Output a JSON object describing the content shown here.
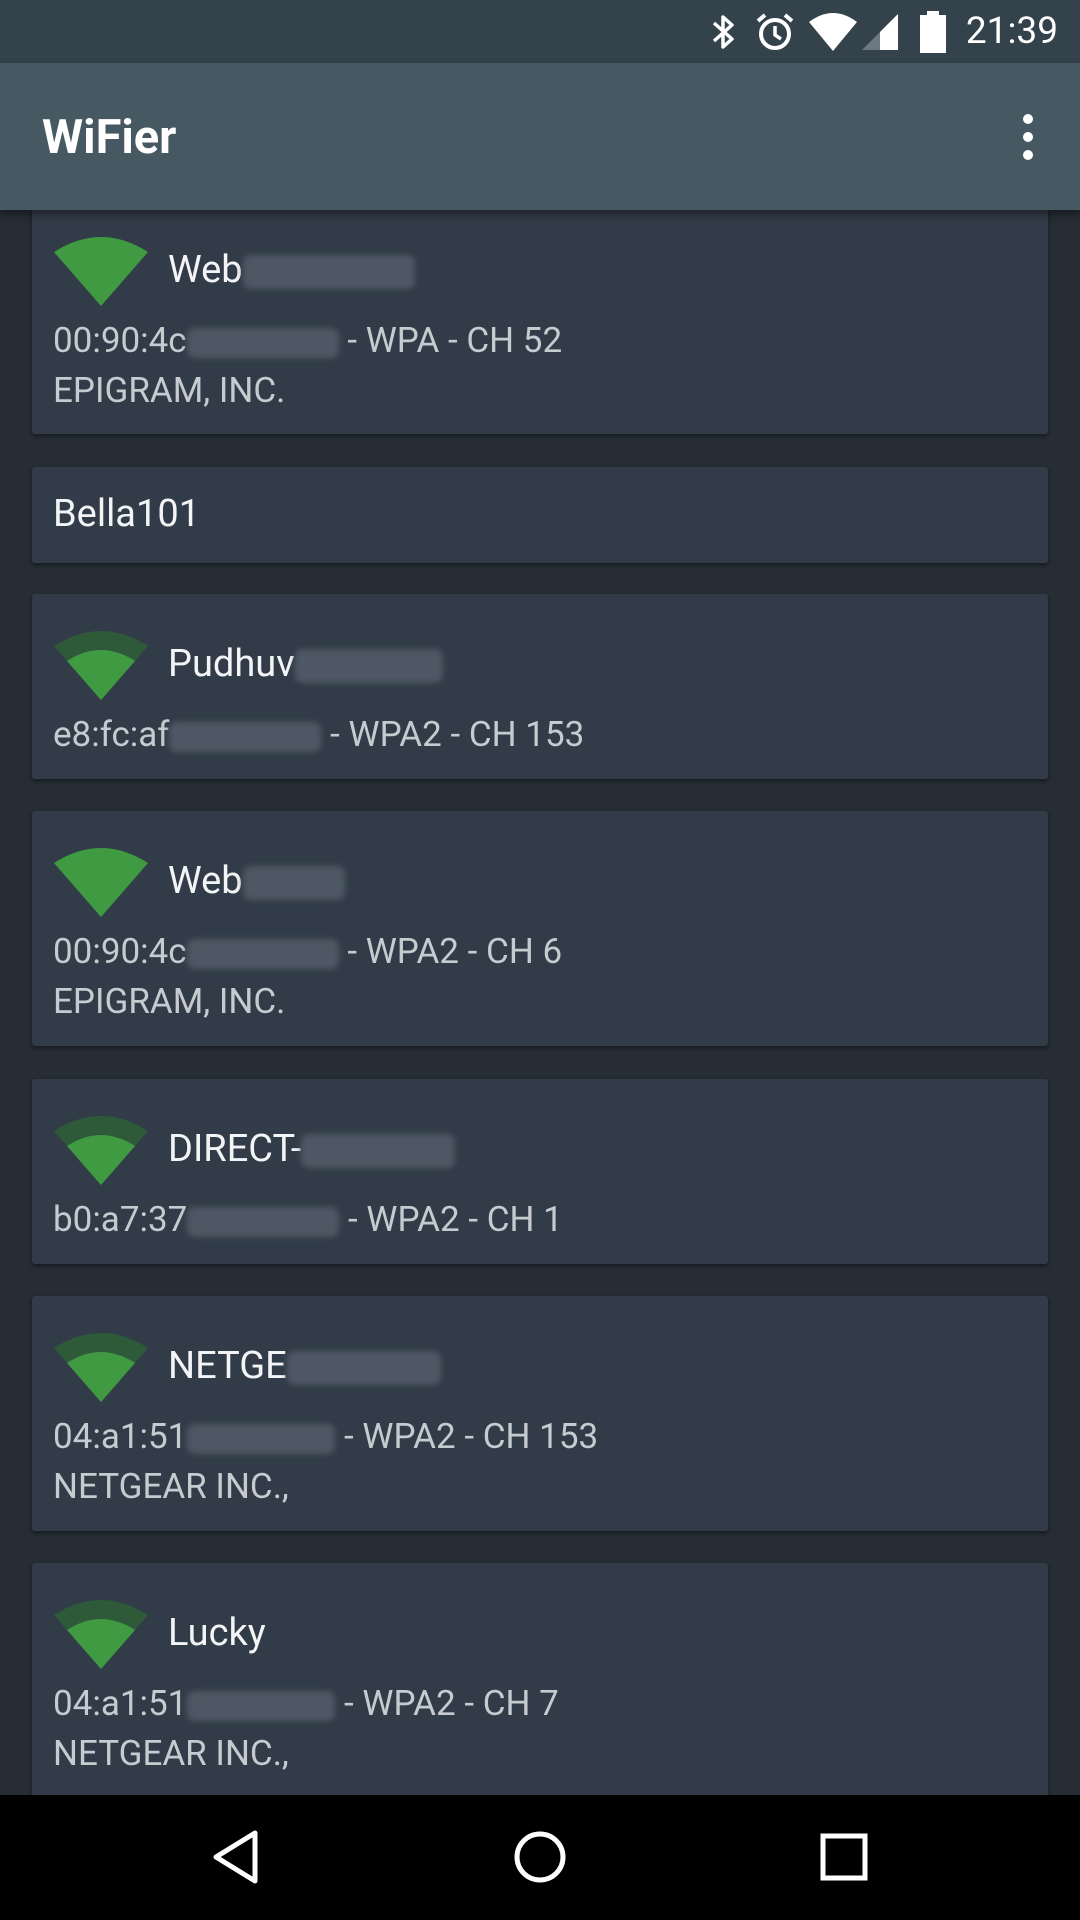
{
  "status_bar": {
    "time": "21:39",
    "icons": [
      "bluetooth-icon",
      "alarm-icon",
      "wifi-signal-icon",
      "cell-signal-icon",
      "battery-icon"
    ]
  },
  "app_bar": {
    "title": "WiFier",
    "menu_icon": "more-vert-icon"
  },
  "networks": [
    {
      "ssid": "Web",
      "mac": "00:90:4c",
      "security": "WPA",
      "channel": "CH 52",
      "vendor": "EPIGRAM, INC.",
      "signal": "full"
    },
    {
      "ssid": "Bella101",
      "mac": "",
      "security": "",
      "channel": "",
      "vendor": "",
      "signal": "none"
    },
    {
      "ssid": "Pudhuv",
      "mac": "e8:fc:af",
      "security": "WPA2",
      "channel": "CH 153",
      "vendor": "",
      "signal": "medium"
    },
    {
      "ssid": "Web",
      "mac": "00:90:4c",
      "security": "WPA2",
      "channel": "CH 6",
      "vendor": "EPIGRAM, INC.",
      "signal": "full"
    },
    {
      "ssid": "DIRECT-",
      "mac": "b0:a7:37",
      "security": "WPA2",
      "channel": "CH 1",
      "vendor": "",
      "signal": "medium"
    },
    {
      "ssid": "NETGE",
      "mac": "04:a1:51",
      "security": "WPA2",
      "channel": "CH 153",
      "vendor": "NETGEAR INC.,",
      "signal": "medium"
    },
    {
      "ssid": "Lucky",
      "mac": "04:a1:51",
      "security": "WPA2",
      "channel": "CH 7",
      "vendor": "NETGEAR INC.,",
      "signal": "medium"
    }
  ],
  "separator": "-",
  "colors": {
    "signal_active": "#3f9a42",
    "signal_inactive": "#2f5a3a"
  },
  "nav_bar": {
    "icons": [
      "back-icon",
      "home-icon",
      "recents-icon"
    ]
  }
}
